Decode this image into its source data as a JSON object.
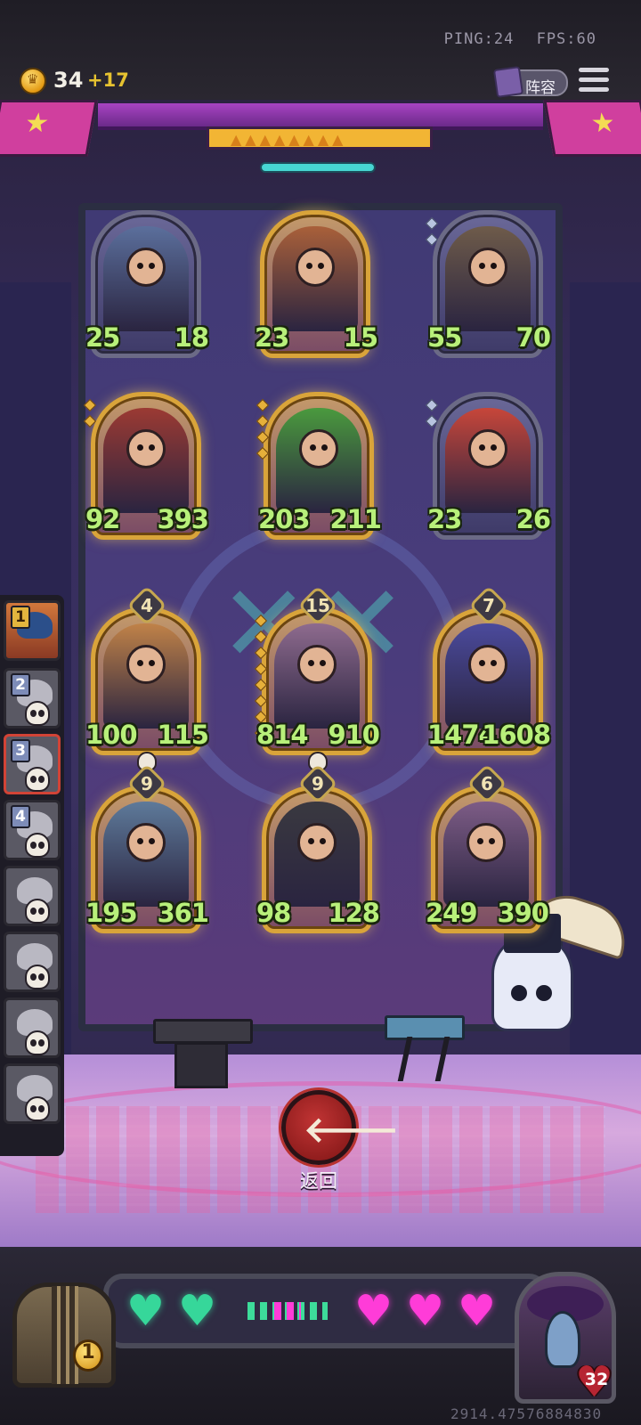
{
  "network": {
    "ping": "PING:24",
    "fps": "FPS:60"
  },
  "currency": {
    "gold": "34",
    "gold_income": "+17"
  },
  "toolbar": {
    "lineup_label": "阵容"
  },
  "board": {
    "heroes": [
      {
        "id": "hero-1",
        "attack": "25",
        "health": "18",
        "tier": "",
        "portrait_color": "#5b6f9c"
      },
      {
        "id": "hero-2",
        "attack": "23",
        "health": "15",
        "tier": "",
        "portrait_color": "#a9603a"
      },
      {
        "id": "hero-3",
        "attack": "55",
        "health": "70",
        "tier": "",
        "portrait_color": "#6e5b4a"
      },
      {
        "id": "hero-4",
        "attack": "92",
        "health": "393",
        "tier": "",
        "portrait_color": "#9b3a33"
      },
      {
        "id": "hero-5",
        "attack": "203",
        "health": "211",
        "tier": "",
        "portrait_color": "#4a9a3e"
      },
      {
        "id": "hero-6",
        "attack": "23",
        "health": "26",
        "tier": "",
        "portrait_color": "#c7463a"
      },
      {
        "id": "hero-7",
        "attack": "100",
        "health": "115",
        "tier": "4",
        "portrait_color": "#c08248"
      },
      {
        "id": "hero-8",
        "attack": "814",
        "health": "910",
        "tier": "15",
        "portrait_color": "#8e6b8e"
      },
      {
        "id": "hero-9",
        "attack": "1474",
        "health": "1608",
        "tier": "7",
        "portrait_color": "#4b4a9c"
      },
      {
        "id": "hero-10",
        "attack": "195",
        "health": "361",
        "tier": "9",
        "portrait_color": "#5e7a9a"
      },
      {
        "id": "hero-11",
        "attack": "98",
        "health": "128",
        "tier": "9",
        "portrait_color": "#3a3940"
      },
      {
        "id": "hero-12",
        "attack": "249",
        "health": "390",
        "tier": "6",
        "portrait_color": "#7d5c86"
      }
    ]
  },
  "queue": {
    "slots": [
      "1",
      "2",
      "3",
      "4",
      "",
      "",
      "",
      ""
    ]
  },
  "back": {
    "label": "返回",
    "icon": "arrow-left-icon"
  },
  "player": {
    "level": "1",
    "health": "32",
    "hearts_green": 2,
    "hearts_pink": 3
  },
  "footer": {
    "game_id": "2914.47576884830"
  },
  "colors": {
    "stat_green": "#b8f07a",
    "heart_green": "#36d79a",
    "heart_pink": "#ff3cd8",
    "back_red": "#c13434"
  }
}
